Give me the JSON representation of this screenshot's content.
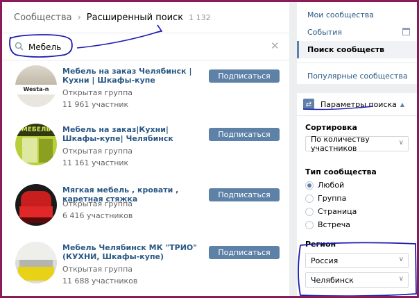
{
  "breadcrumb": {
    "parent": "Сообщества",
    "current": "Расширенный поиск",
    "count": "1 132"
  },
  "search": {
    "value": "Мебель"
  },
  "results": [
    {
      "title": "Мебель на заказ Челябинск | Кухни | Шкафы-купе",
      "type": "Открытая группа",
      "members": "11 961 участник",
      "button": "Подписаться"
    },
    {
      "title": "Мебель на заказ|Кухни|Шкафы-купе| Челябинск",
      "type": "Открытая группа",
      "members": "11 161 участник",
      "button": "Подписаться"
    },
    {
      "title": "Мягкая мебель , кровати , каретная стяжка",
      "type": "Открытая группа",
      "members": "6 416 участников",
      "button": "Подписаться"
    },
    {
      "title": "Мебель Челябинск МК \"ТРИО\" (КУХНИ, Шкафы-купе)",
      "type": "Открытая группа",
      "members": "11 688 участников",
      "button": "Подписаться"
    }
  ],
  "avatar_text": {
    "westa": "Westa-n",
    "mebel": "МЕБЕЛЬ"
  },
  "menu": {
    "my": "Мои сообщества",
    "events": "События",
    "search": "Поиск сообществ",
    "popular": "Популярные сообщества"
  },
  "params": {
    "title": "Параметры поиска",
    "sort_label": "Сортировка",
    "sort_value": "По количеству участников",
    "type_label": "Тип сообщества",
    "types": [
      "Любой",
      "Группа",
      "Страница",
      "Встреча"
    ],
    "region_label": "Регион",
    "country": "Россия",
    "city": "Челябинск"
  },
  "colors": {
    "accent": "#5e81a8",
    "link": "#2a5885",
    "border": "#8a1a5a",
    "annotation": "#1b1bb0"
  }
}
